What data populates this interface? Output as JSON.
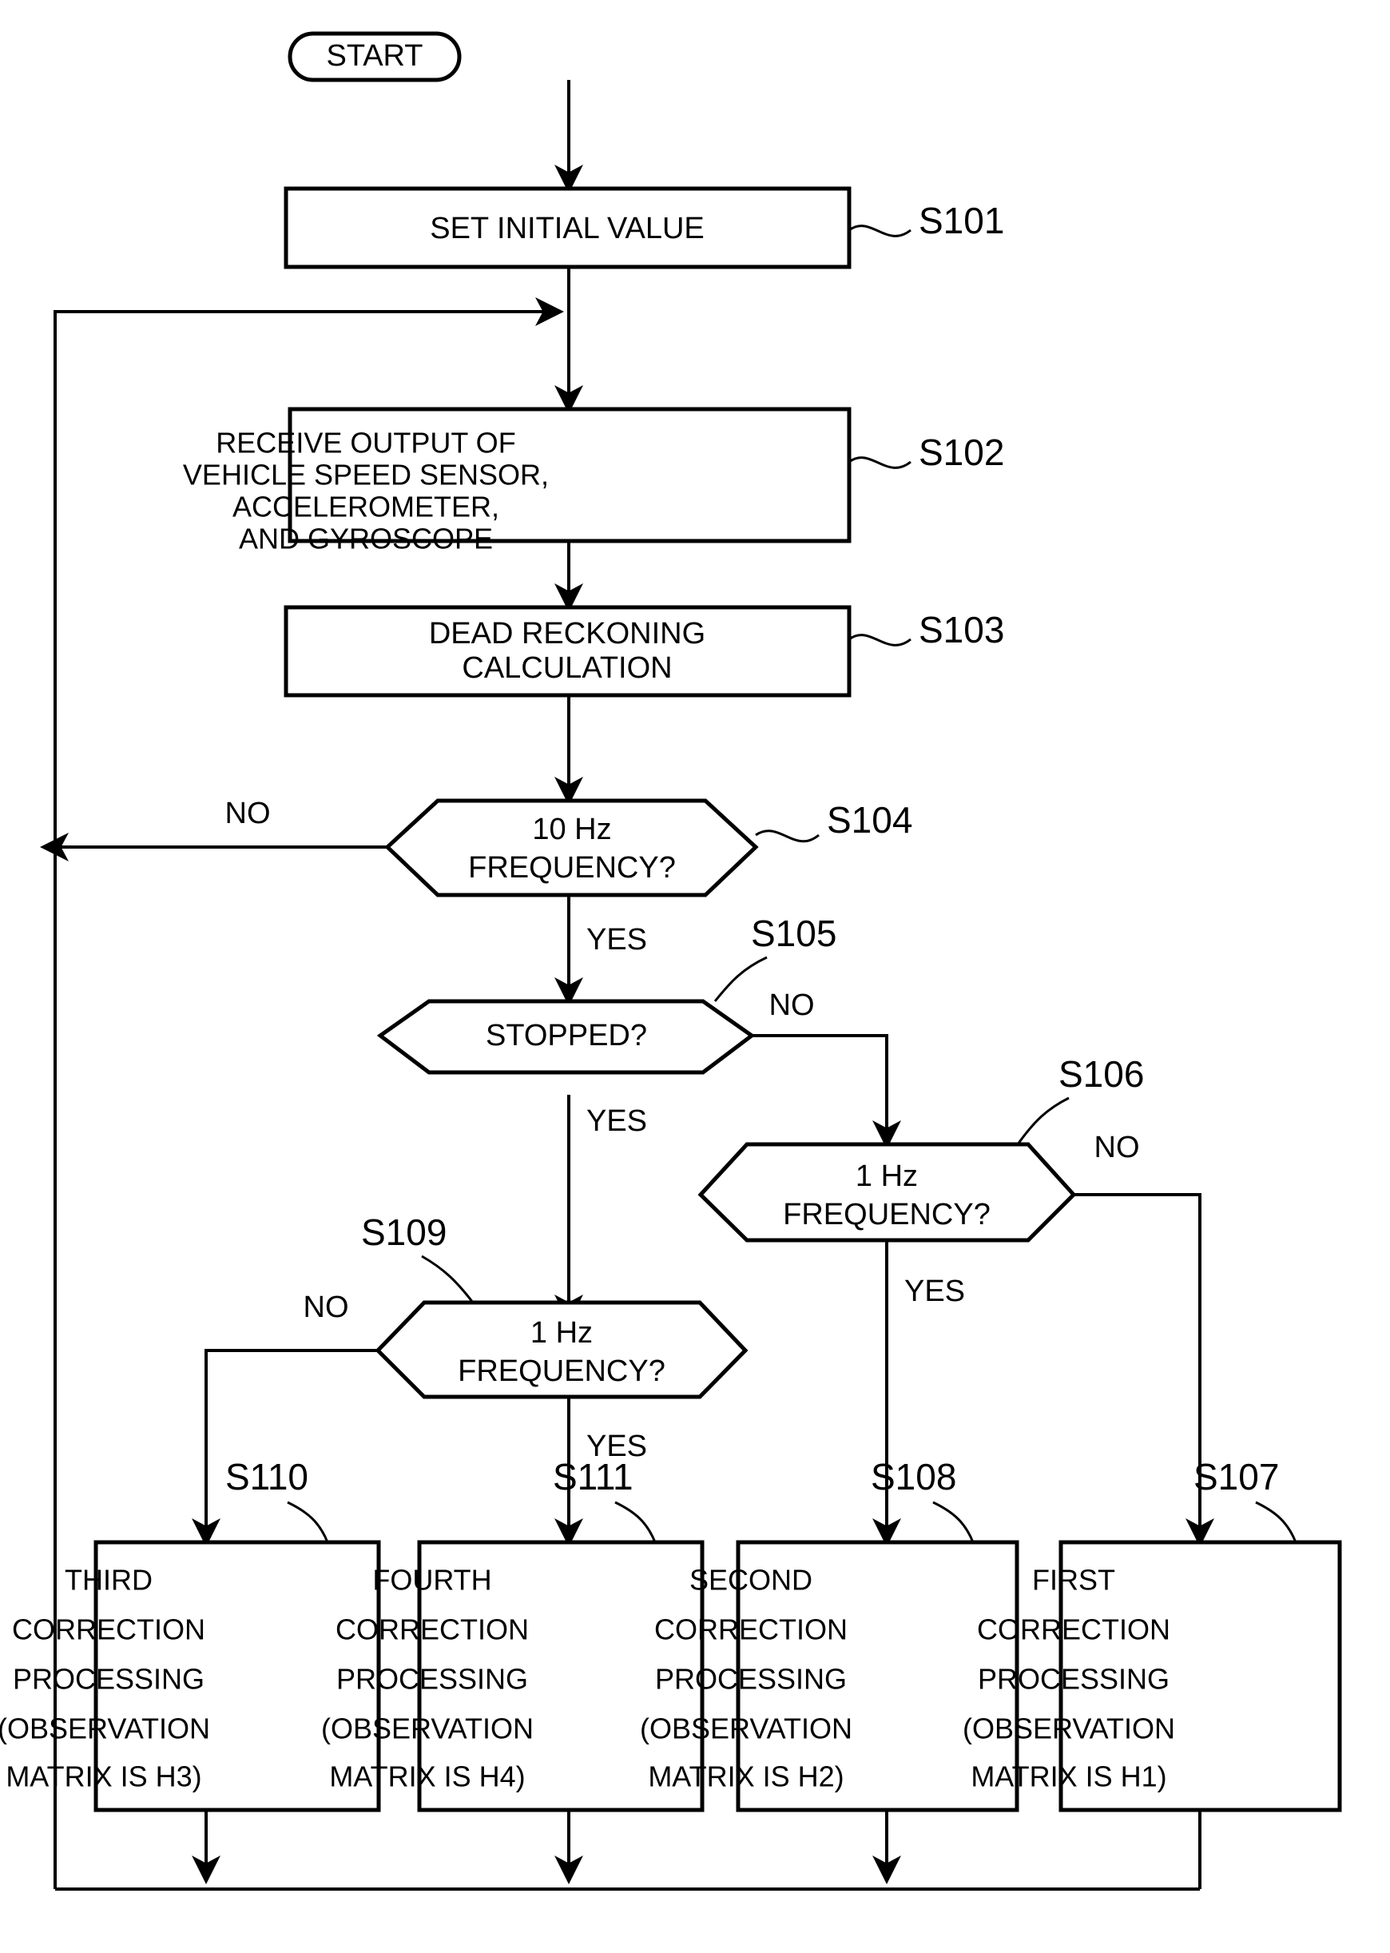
{
  "diagram": {
    "type": "flowchart",
    "title": "",
    "nodes": [
      {
        "id": "start",
        "shape": "terminator",
        "step": "",
        "lines": [
          "START"
        ]
      },
      {
        "id": "s101",
        "shape": "process",
        "step": "S101",
        "lines": [
          "SET INITIAL VALUE"
        ]
      },
      {
        "id": "s102",
        "shape": "process",
        "step": "S102",
        "lines": [
          "RECEIVE OUTPUT OF",
          "VEHICLE SPEED SENSOR,",
          "ACCELEROMETER,",
          "AND GYROSCOPE"
        ]
      },
      {
        "id": "s103",
        "shape": "process",
        "step": "S103",
        "lines": [
          "DEAD RECKONING",
          "CALCULATION"
        ]
      },
      {
        "id": "s104",
        "shape": "decision",
        "step": "S104",
        "lines": [
          "10 Hz",
          "FREQUENCY?"
        ]
      },
      {
        "id": "s105",
        "shape": "decision",
        "step": "S105",
        "lines": [
          "STOPPED?"
        ]
      },
      {
        "id": "s106",
        "shape": "decision",
        "step": "S106",
        "lines": [
          "1 Hz",
          "FREQUENCY?"
        ]
      },
      {
        "id": "s109",
        "shape": "decision",
        "step": "S109",
        "lines": [
          "1 Hz",
          "FREQUENCY?"
        ]
      },
      {
        "id": "s110",
        "shape": "process",
        "step": "S110",
        "lines": [
          "THIRD",
          "CORRECTION",
          "PROCESSING",
          "(OBSERVATION",
          "MATRIX IS H3)"
        ]
      },
      {
        "id": "s111",
        "shape": "process",
        "step": "S111",
        "lines": [
          "FOURTH",
          "CORRECTION",
          "PROCESSING",
          "(OBSERVATION",
          "MATRIX IS H4)"
        ]
      },
      {
        "id": "s108",
        "shape": "process",
        "step": "S108",
        "lines": [
          "SECOND",
          "CORRECTION",
          "PROCESSING",
          "(OBSERVATION",
          "MATRIX IS H2)"
        ]
      },
      {
        "id": "s107",
        "shape": "process",
        "step": "S107",
        "lines": [
          "FIRST",
          "CORRECTION",
          "PROCESSING",
          "(OBSERVATION",
          "MATRIX IS H1)"
        ]
      }
    ],
    "edge_labels": {
      "s104_no": "NO",
      "s104_yes": "YES",
      "s105_no": "NO",
      "s105_yes": "YES",
      "s106_no": "NO",
      "s106_yes": "YES",
      "s109_no": "NO",
      "s109_yes": "YES"
    },
    "colors": {
      "stroke": "#000000",
      "fill": "#ffffff",
      "background": "#ffffff"
    }
  }
}
